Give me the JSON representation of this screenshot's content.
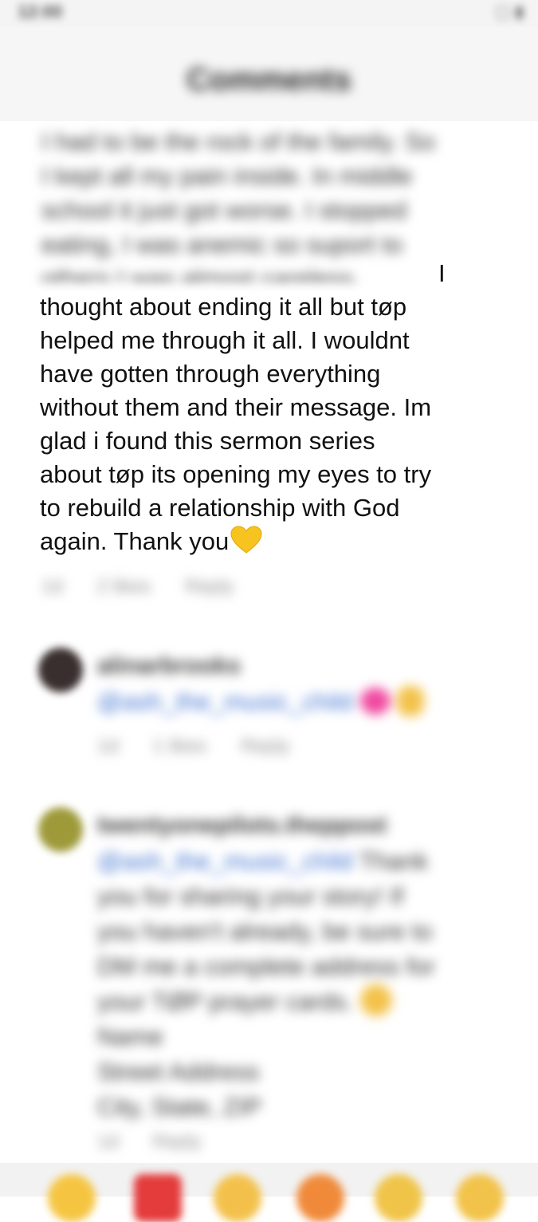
{
  "status_bar": {
    "time": "12:00",
    "icons": "▢ ▮"
  },
  "header": {
    "title": "Comments"
  },
  "comment_main": {
    "blurred_lines": [
      "I had to be the rock of the family. So",
      "I kept all my pain inside. In middle",
      "school it just got worse. I stopped",
      "eating, I was anemic so suport to",
      "others I was almost careless."
    ],
    "clear_start": "I",
    "clear_lines": [
      "thought about ending it all but tøp",
      "helped me through it all. I wouldnt",
      "have gotten through everything",
      "without them and their message. Im",
      "glad i found this sermon series",
      "about tøp its opening my eyes to try",
      "to rebuild a relationship with God",
      "again. Thank you"
    ],
    "heart_icon": "yellow-heart",
    "meta": {
      "time": "1d",
      "likes": "2 likes",
      "reply": "Reply"
    }
  },
  "comment_2": {
    "username": "alinarbrooks",
    "mention": "@ash_the_music_child",
    "meta": {
      "time": "1d",
      "likes": "1 likes",
      "reply": "Reply"
    }
  },
  "comment_3": {
    "username": "twentyonepilots.theppost",
    "mention": "@ash_the_music_child",
    "text_lines": [
      "Thank",
      "you for sharing your story! If",
      "you haven't already, be sure to",
      "DM me a complete address for",
      "your TØP prayer cards."
    ],
    "extra_lines": [
      "Name",
      "Street Address",
      "City, State, ZIP"
    ],
    "meta": {
      "time": "1d",
      "likes": "Reply"
    }
  },
  "emoji_bar": {
    "colors": [
      "#f5c542",
      "#e43b3b",
      "#f3c14b",
      "#f08a3a",
      "#f0c448",
      "#f2c34a"
    ]
  }
}
